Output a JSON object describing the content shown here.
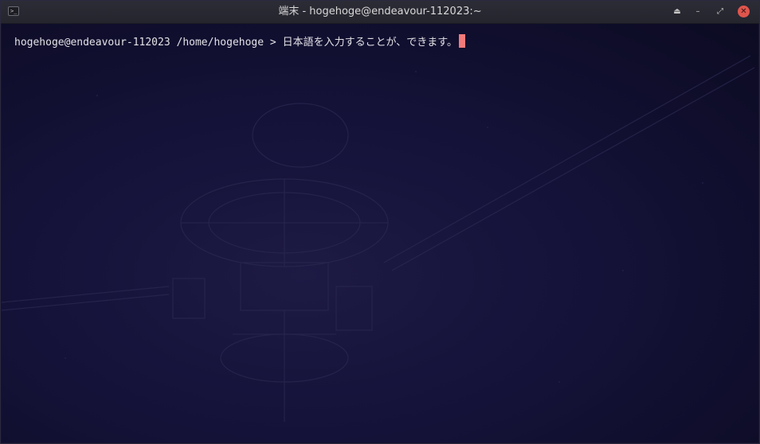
{
  "window": {
    "title": "端末 - hogehoge@endeavour-112023:~",
    "app_icon_glyph": ">_",
    "buttons": {
      "shade": "⏏",
      "minimize": "–",
      "maximize": "⤢",
      "close": "✕"
    }
  },
  "terminal": {
    "prompt_user_host": "hogehoge@endeavour-112023",
    "prompt_path": "/home/hogehoge",
    "prompt_symbol": ">",
    "input_text": "日本語を入力することが、できます。",
    "cursor_color": "#f27a7a"
  }
}
